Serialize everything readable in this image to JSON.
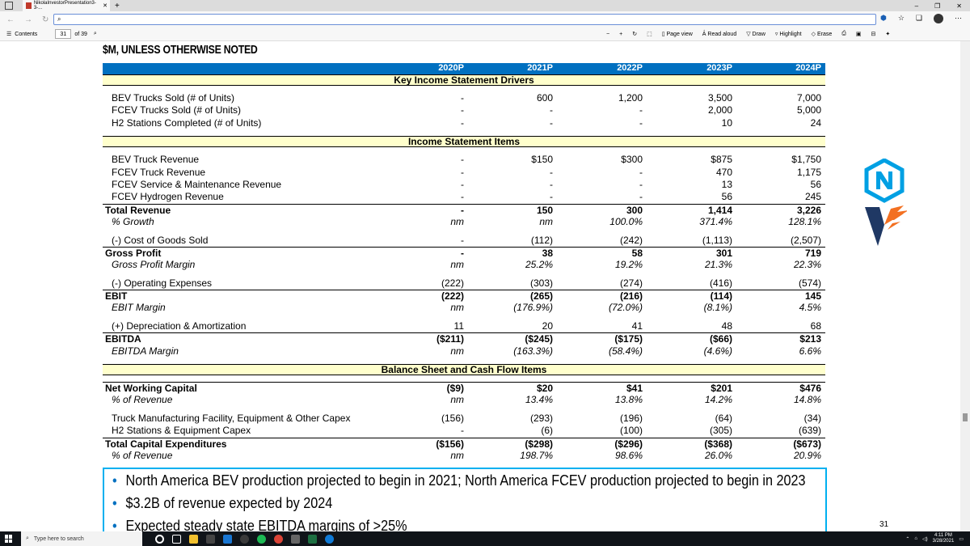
{
  "browser": {
    "tab_title": "NikolaInvestorPresentation3-3-...",
    "url": "",
    "window_controls": [
      "–",
      "❐",
      "✕"
    ]
  },
  "pdf_toolbar": {
    "contents_label": "Contents",
    "page_number": "31",
    "page_total": "of 39",
    "page_view": "Page view",
    "read_aloud": "Read aloud",
    "draw": "Draw",
    "highlight": "Highlight",
    "erase": "Erase"
  },
  "slide": {
    "heading": "$M, UNLESS OTHERWISE NOTED",
    "years": [
      "2020P",
      "2021P",
      "2022P",
      "2023P",
      "2024P"
    ],
    "section1": "Key Income Statement Drivers",
    "drivers": [
      {
        "label": "BEV Trucks Sold (# of Units)",
        "v": [
          "-",
          "600",
          "1,200",
          "3,500",
          "7,000"
        ]
      },
      {
        "label": "FCEV Trucks Sold (# of Units)",
        "v": [
          "-",
          "-",
          "-",
          "2,000",
          "5,000"
        ]
      },
      {
        "label": "H2 Stations Completed (# of Units)",
        "v": [
          "-",
          "-",
          "-",
          "10",
          "24"
        ]
      }
    ],
    "section2": "Income Statement Items",
    "revenue": [
      {
        "label": "BEV Truck Revenue",
        "v": [
          "-",
          "$150",
          "$300",
          "$875",
          "$1,750"
        ]
      },
      {
        "label": "FCEV Truck Revenue",
        "v": [
          "-",
          "-",
          "-",
          "470",
          "1,175"
        ]
      },
      {
        "label": "FCEV Service & Maintenance Revenue",
        "v": [
          "-",
          "-",
          "-",
          "13",
          "56"
        ]
      },
      {
        "label": "FCEV Hydrogen Revenue",
        "v": [
          "-",
          "-",
          "-",
          "56",
          "245"
        ]
      }
    ],
    "total_revenue": {
      "label": "Total Revenue",
      "v": [
        "-",
        "150",
        "300",
        "1,414",
        "3,226"
      ]
    },
    "growth": {
      "label": "% Growth",
      "v": [
        "nm",
        "nm",
        "100.0%",
        "371.4%",
        "128.1%"
      ]
    },
    "cogs": {
      "label": "(-) Cost of Goods Sold",
      "v": [
        "-",
        "(112)",
        "(242)",
        "(1,113)",
        "(2,507)"
      ]
    },
    "gross_profit": {
      "label": "Gross Profit",
      "v": [
        "-",
        "38",
        "58",
        "301",
        "719"
      ]
    },
    "gross_margin": {
      "label": "Gross Profit Margin",
      "v": [
        "nm",
        "25.2%",
        "19.2%",
        "21.3%",
        "22.3%"
      ]
    },
    "opex": {
      "label": "(-) Operating Expenses",
      "v": [
        "(222)",
        "(303)",
        "(274)",
        "(416)",
        "(574)"
      ]
    },
    "ebit": {
      "label": "EBIT",
      "v": [
        "(222)",
        "(265)",
        "(216)",
        "(114)",
        "145"
      ]
    },
    "ebit_margin": {
      "label": "EBIT Margin",
      "v": [
        "nm",
        "(176.9%)",
        "(72.0%)",
        "(8.1%)",
        "4.5%"
      ]
    },
    "da": {
      "label": "(+) Depreciation & Amortization",
      "v": [
        "11",
        "20",
        "41",
        "48",
        "68"
      ]
    },
    "ebitda": {
      "label": "EBITDA",
      "v": [
        "($211)",
        "($245)",
        "($175)",
        "($66)",
        "$213"
      ]
    },
    "ebitda_margin": {
      "label": "EBITDA Margin",
      "v": [
        "nm",
        "(163.3%)",
        "(58.4%)",
        "(4.6%)",
        "6.6%"
      ]
    },
    "section3": "Balance Sheet and Cash Flow Items",
    "nwc": {
      "label": "Net Working Capital",
      "v": [
        "($9)",
        "$20",
        "$41",
        "$201",
        "$476"
      ]
    },
    "nwc_pct": {
      "label": "% of Revenue",
      "v": [
        "nm",
        "13.4%",
        "13.8%",
        "14.2%",
        "14.8%"
      ]
    },
    "capex1": {
      "label": "Truck Manufacturing Facility, Equipment & Other Capex",
      "v": [
        "(156)",
        "(293)",
        "(196)",
        "(64)",
        "(34)"
      ]
    },
    "capex2": {
      "label": "H2 Stations & Equipment Capex",
      "v": [
        "-",
        "(6)",
        "(100)",
        "(305)",
        "(639)"
      ]
    },
    "total_capex": {
      "label": "Total Capital Expenditures",
      "v": [
        "($156)",
        "($298)",
        "($296)",
        "($368)",
        "($673)"
      ]
    },
    "capex_pct": {
      "label": "% of Revenue",
      "v": [
        "nm",
        "198.7%",
        "98.6%",
        "26.0%",
        "20.9%"
      ]
    },
    "bullets": [
      "North America BEV production projected to begin in 2021; North America FCEV production projected to begin in 2023",
      "$3.2B of revenue expected by 2024",
      "Expected steady state EBITDA margins of >25%"
    ],
    "page_number": "31"
  },
  "taskbar": {
    "search_placeholder": "Type here to search",
    "time": "4:11 PM",
    "date": "3/28/2021"
  }
}
